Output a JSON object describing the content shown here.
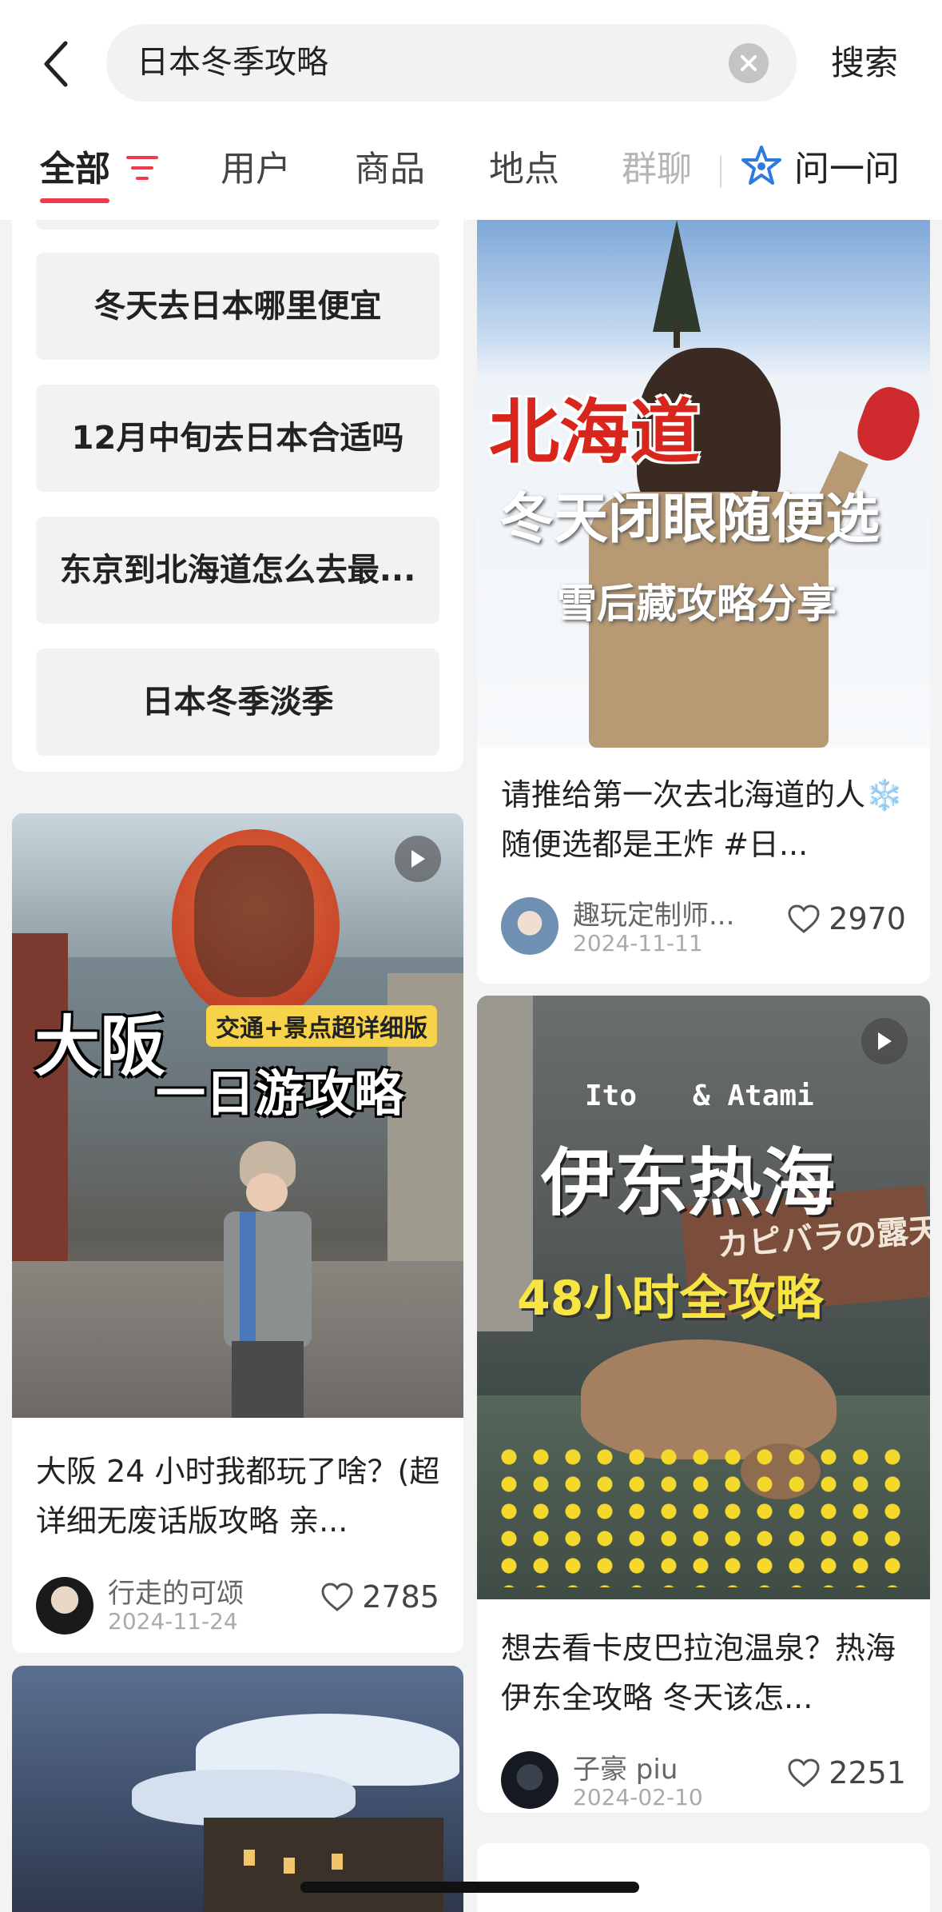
{
  "search": {
    "query": "日本冬季攻略",
    "submit_label": "搜索"
  },
  "tabs": [
    {
      "label": "全部"
    },
    {
      "label": "用户"
    },
    {
      "label": "商品"
    },
    {
      "label": "地点"
    },
    {
      "label": "群聊"
    },
    {
      "label": "问一问"
    }
  ],
  "suggestions": [
    "冬天去日本哪里便宜",
    "12月中旬去日本合适吗",
    "东京到北海道怎么去最...",
    "日本冬季淡季"
  ],
  "notes": [
    {
      "overlay": [
        "大阪",
        "交通+景点超详细版",
        "一日游攻略"
      ],
      "title": "大阪 24 小时我都玩了啥？(超详细无废话版攻略 亲...",
      "author": "行走的可颂",
      "date": "2024-11-24",
      "likes": "2785"
    },
    {
      "overlay": [
        "北海道",
        "冬天闭眼随便选",
        "雪后藏攻略分享"
      ],
      "title": "请推给第一次去北海道的人❄️随便选都是王炸 #日...",
      "author": "趣玩定制师...",
      "date": "2024-11-11",
      "likes": "2970"
    },
    {
      "overlay": [
        "Ito",
        "& Atami",
        "伊东热海",
        "カピバラの露天",
        "48小时全攻略"
      ],
      "title": "想去看卡皮巴拉泡温泉？热海伊东全攻略 冬天该怎...",
      "author": "子豪 piu",
      "date": "2024-02-10",
      "likes": "2251"
    }
  ],
  "colors": {
    "accent": "#ef3b4b",
    "background": "#f3f3f3"
  }
}
